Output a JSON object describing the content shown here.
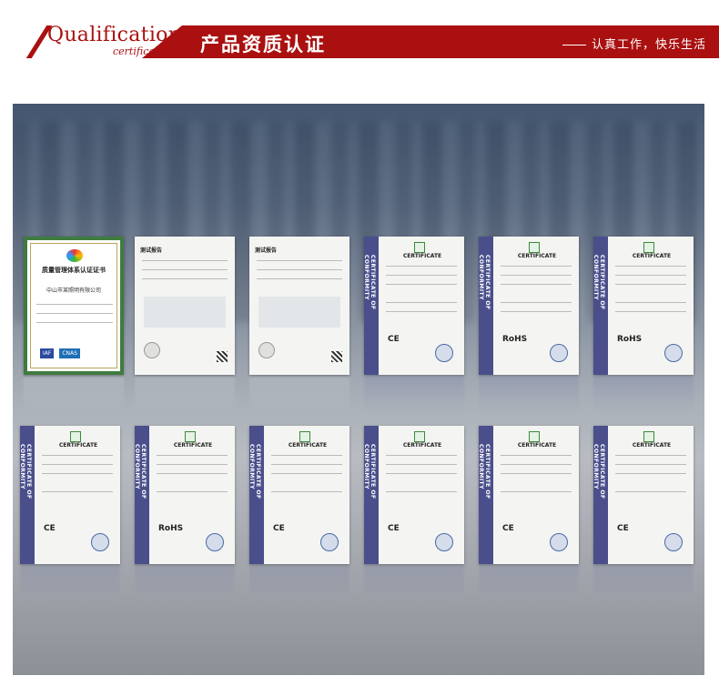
{
  "header": {
    "title_en": "Qualification",
    "subtitle_en": "certification",
    "title_cn": "产品资质认证",
    "slogan": "认真工作，快乐生活",
    "accent_color": "#aa1010"
  },
  "certificates": {
    "band_text": "CERTIFICATE OF CONFORMITY",
    "heading": "CERTIFICATE",
    "quality_cert_title": "质量管理体系认证证书",
    "quality_cert_company": "中山市某照明有限公司",
    "test_report_title": "测试报告",
    "iaf_label": "IAF",
    "cnas_label": "CNAS",
    "marks": {
      "ce": "CE",
      "rohs": "RoHS"
    }
  }
}
